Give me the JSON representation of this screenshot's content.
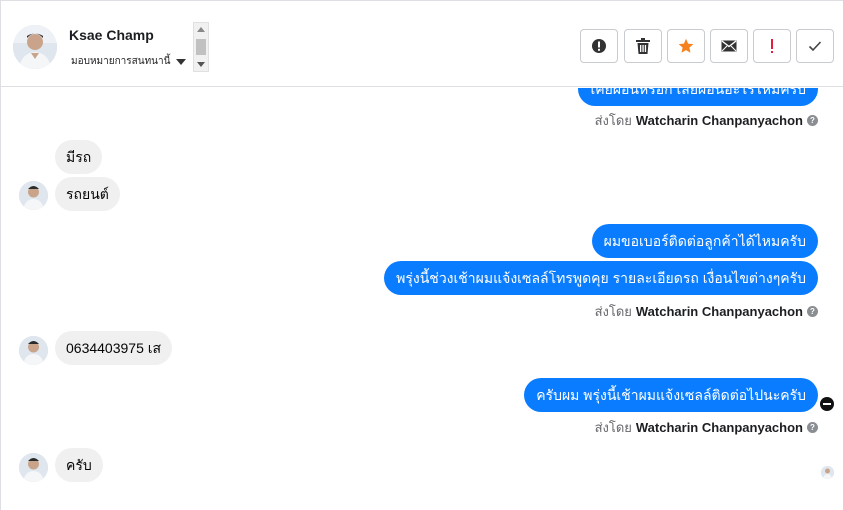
{
  "header": {
    "contact_name": "Ksae Champ",
    "assign_label": "มอบหมายการสนทนานี้"
  },
  "toolbar": {
    "buttons": [
      {
        "name": "spam",
        "icon": "alert-circle-icon"
      },
      {
        "name": "delete",
        "icon": "trash-icon"
      },
      {
        "name": "star",
        "icon": "star-icon",
        "color": "#f5821f"
      },
      {
        "name": "email",
        "icon": "envelope-icon"
      },
      {
        "name": "follow-up",
        "icon": "exclamation-icon",
        "color": "#e41e3f"
      },
      {
        "name": "done",
        "icon": "check-icon"
      }
    ]
  },
  "messages": {
    "out_0": "เคยผ่อนหรือก็ เสียผ่อนอะไรไหมครับ",
    "sent_by_prefix": "ส่งโดย",
    "sender_name": "Watcharin Chanpanyachon",
    "in_1": "มีรถ",
    "in_2": "รถยนต์",
    "out_3": "ผมขอเบอร์ติดต่อลูกค้าได้ไหมครับ",
    "out_4": "พรุ่งนี้ช่วงเช้าผมแจ้งเซลล์โทรพูดคุย รายละเอียดรถ เงื่อนไขต่างๆครับ",
    "in_5": "0634403975 เส",
    "out_6": "ครับผม พรุ่งนี้เช้าผมแจ้งเซลล์ติดต่อไปนะครับ",
    "in_7": "ครับ"
  },
  "colors": {
    "outgoing_bubble": "#0a7cff",
    "incoming_bubble": "#f0f0f0",
    "star": "#f5821f",
    "exclamation": "#e41e3f"
  }
}
